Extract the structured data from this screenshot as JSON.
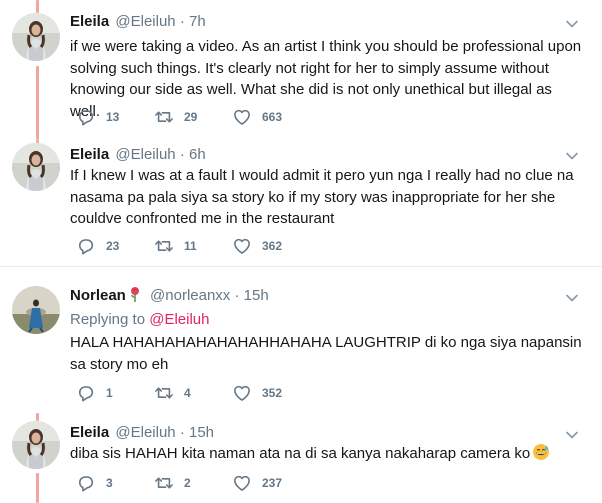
{
  "tweets": [
    {
      "name": "Eleila",
      "handle": "@Eleiluh",
      "dot": "·",
      "time": "7h",
      "text": "if we were taking a video. As an artist I think you should be professional upon solving such things. It's clearly not right for her to simply assume without knowing our side as well. What she did is not only unethical but illegal as well.",
      "replies": "13",
      "retweets": "29",
      "likes": "663"
    },
    {
      "name": "Eleila",
      "handle": "@Eleiluh",
      "dot": "·",
      "time": "6h",
      "text": "If I knew I was at a fault I would admit it pero yun nga I really had no clue na nasama pa pala siya sa story ko if my story was inappropriate for her she couldve confronted me in the restaurant",
      "replies": "23",
      "retweets": "11",
      "likes": "362"
    },
    {
      "name": "Norlean",
      "handle": "@norleanxx",
      "dot": "·",
      "time": "15h",
      "reply_prefix": "Replying to ",
      "reply_to": "@Eleiluh",
      "text": "HALA HAHAHAHAHAHAHAHHAHAHA LAUGHTRIP di ko nga siya napansin sa story mo eh",
      "replies": "1",
      "retweets": "4",
      "likes": "352"
    },
    {
      "name": "Eleila",
      "handle": "@Eleiluh",
      "dot": "·",
      "time": "15h",
      "text": "diba sis HAHAH kita naman ata na di sa kanya nakaharap camera ko",
      "replies": "3",
      "retweets": "2",
      "likes": "237"
    }
  ],
  "icons": {
    "reply": "reply-icon",
    "retweet": "retweet-icon",
    "like": "heart-icon",
    "more": "chevron-down-icon",
    "emoji": "grinning-sweat-emoji",
    "badge": "rose-emoji"
  },
  "colors": {
    "thread_line": "#f2a6a4",
    "secondary_text": "#657786",
    "mention": "#e0245e",
    "divider": "#e6ecf0"
  }
}
